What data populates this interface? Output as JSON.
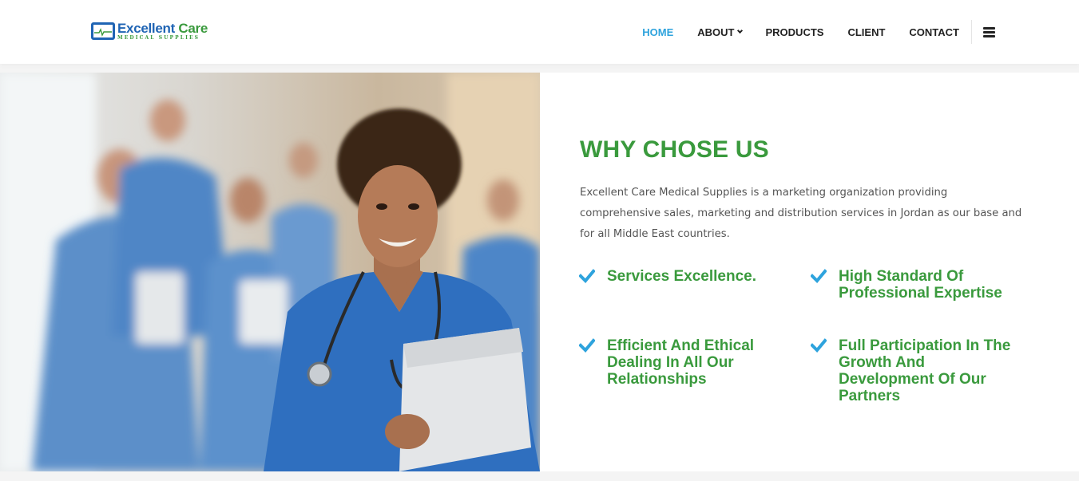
{
  "brand": {
    "name_part1": "Excellent",
    "name_part2": "Care",
    "tagline": "MEDICAL SUPPLIES"
  },
  "nav": {
    "items": [
      {
        "label": "HOME",
        "active": true
      },
      {
        "label": "ABOUT",
        "has_dropdown": true
      },
      {
        "label": "PRODUCTS"
      },
      {
        "label": "CLIENT"
      },
      {
        "label": "CONTACT"
      }
    ],
    "menu_icon": "hamburger-icon"
  },
  "hero": {
    "image": "smiling nurse in blue scrubs with stethoscope holding clipboard, blurred medical staff in background"
  },
  "why": {
    "title": "WHY CHOSE US",
    "description": "Excellent Care Medical Supplies is a marketing organization providing comprehensive sales, marketing and distribution services in Jordan as our base and for all Middle East countries.",
    "features": [
      "Services Excellence.",
      "High Standard Of Professional Expertise",
      "Efficient And Ethical Dealing In All Our Relationships",
      "Full Participation In The Growth And Development Of Our Partners"
    ]
  },
  "colors": {
    "brand_green": "#3a9a3d",
    "brand_blue": "#1f64b4",
    "nav_active": "#2ea3dd",
    "check_blue": "#2ea3dd"
  }
}
